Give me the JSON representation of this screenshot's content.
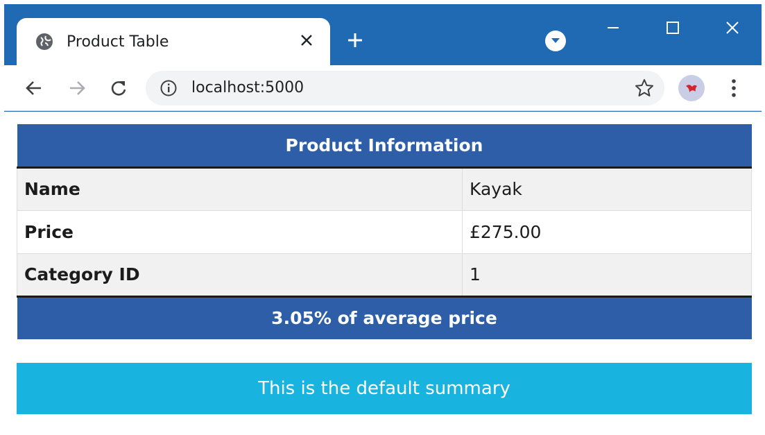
{
  "browser": {
    "tab_title": "Product Table",
    "url": "localhost:5000",
    "colors": {
      "frame": "#1f6ab3",
      "toolbar": "#ffffff",
      "omnibox": "#f1f3f4"
    },
    "icons": [
      "globe-icon",
      "close-icon",
      "plus-icon",
      "tab-search-icon",
      "minimize-icon",
      "maximize-icon",
      "window-close-icon",
      "back-icon",
      "forward-icon",
      "reload-icon",
      "info-icon",
      "star-icon",
      "profile-avatar",
      "menu-icon"
    ]
  },
  "table": {
    "header": "Product Information",
    "rows": [
      {
        "label": "Name",
        "value": "Kayak"
      },
      {
        "label": "Price",
        "value": "£275.00"
      },
      {
        "label": "Category ID",
        "value": "1"
      }
    ],
    "footer": "3.05% of average price",
    "colors": {
      "header_bg": "#2f5ea9",
      "stripe": "#f1f1f1"
    }
  },
  "summary": {
    "text": "This is the default summary",
    "color": "#18b3df"
  }
}
